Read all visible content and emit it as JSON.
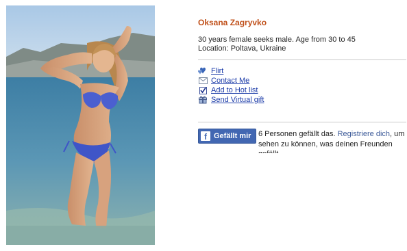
{
  "profile": {
    "name": "Oksana Zagryvko",
    "description": "30 years female seeks male. Age from 30 to 45",
    "location": "Location: Poltava, Ukraine"
  },
  "actions": [
    {
      "label": "Flirt",
      "icon": "hearts-icon"
    },
    {
      "label": "Contact Me",
      "icon": "envelope-icon"
    },
    {
      "label": "Add to Hot list",
      "icon": "checkbox-icon"
    },
    {
      "label": "Send Virtual gift",
      "icon": "gift-icon"
    }
  ],
  "facebook": {
    "button_label": "Gefällt mir",
    "count_text": "6 Personen gefällt das.",
    "register_link": "Registriere dich",
    "rest_text": ", um sehen zu können, was deinen Freunden gefällt."
  },
  "colors": {
    "name": "#c0501a",
    "link": "#1a3aa8",
    "facebook_blue": "#4267b2"
  }
}
